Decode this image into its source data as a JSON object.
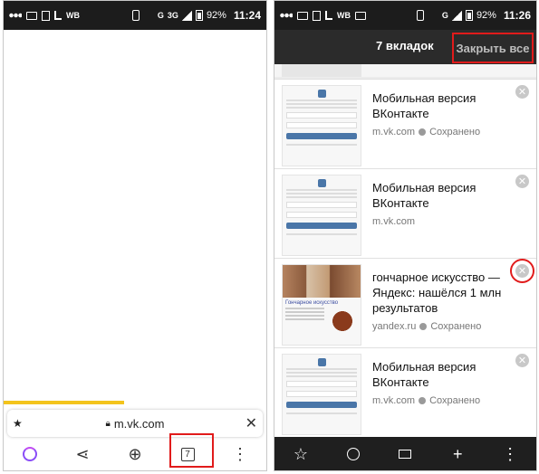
{
  "left_phone": {
    "status_bar": {
      "network_label": "WB",
      "signal_labels": [
        "G",
        "3G"
      ],
      "battery_pct": "92%",
      "time": "11:24"
    },
    "omnibox": {
      "url": "m.vk.com"
    },
    "bottom_bar": {
      "tabs_count": "7"
    },
    "page_load_progress": 0.46
  },
  "right_phone": {
    "status_bar": {
      "network_label": "WB",
      "signal_labels": [
        "G"
      ],
      "battery_pct": "92%",
      "time": "11:26"
    },
    "header": {
      "tabs_title": "7 вкладок",
      "close_all": "Закрыть все"
    },
    "cards": [
      {
        "title": "Мобильная версия ВКонтакте",
        "domain": "m.vk.com",
        "status": "Сохранено",
        "thumb": "vk"
      },
      {
        "title": "Мобильная версия ВКонтакте",
        "domain": "m.vk.com",
        "status": "",
        "thumb": "vk"
      },
      {
        "title": "гончарное искусство — Яндекс: нашёлся 1 млн результатов",
        "domain": "yandex.ru",
        "status": "Сохранено",
        "thumb": "yandex",
        "thumb_caption": "Гончарное искусство"
      },
      {
        "title": "Мобильная версия ВКонтакте",
        "domain": "m.vk.com",
        "status": "Сохранено",
        "thumb": "vk"
      }
    ]
  },
  "colors": {
    "highlight": "#e11b1b",
    "progress": "#f3c41c",
    "alice": "#8a4df7",
    "vk_blue": "#4a76a8"
  },
  "icons": [
    "star-icon",
    "lock-icon",
    "close-icon",
    "alice-icon",
    "share-icon",
    "add-tab-icon",
    "tabs-icon",
    "more-icon",
    "history-icon",
    "devices-icon",
    "plus-icon"
  ]
}
